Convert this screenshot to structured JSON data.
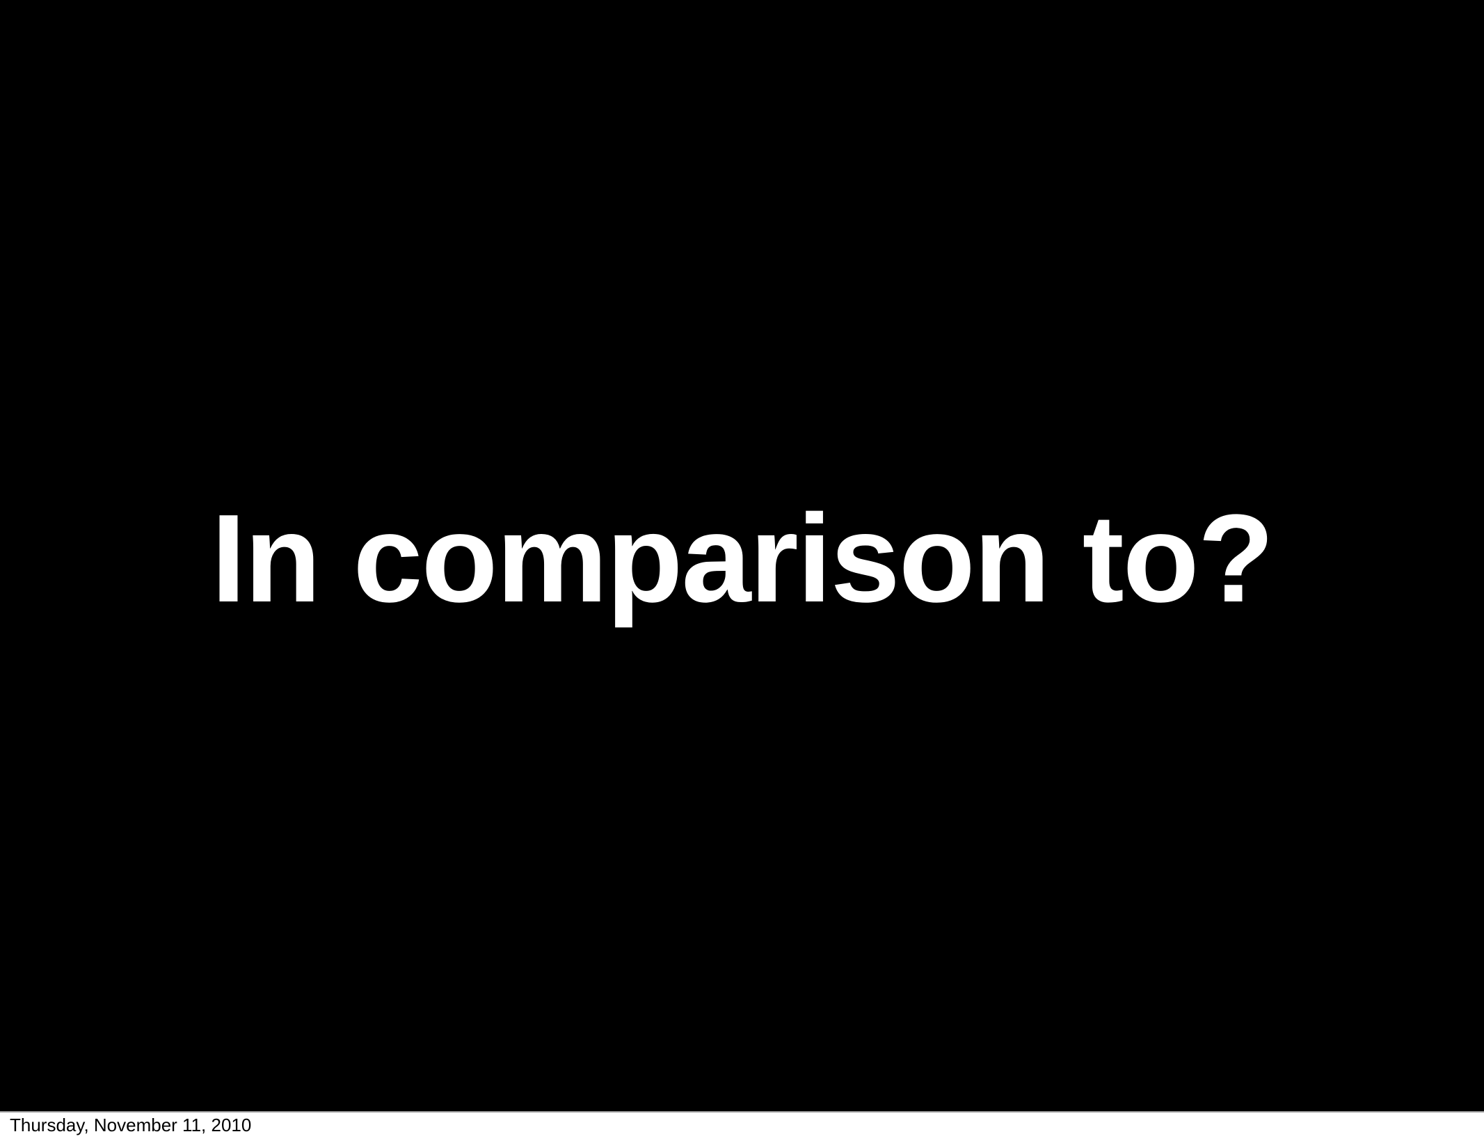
{
  "slide": {
    "title": "In comparison to?",
    "background_color": "#000000",
    "text_color": "#ffffff"
  },
  "footer": {
    "date": "Thursday, November 11, 2010"
  }
}
